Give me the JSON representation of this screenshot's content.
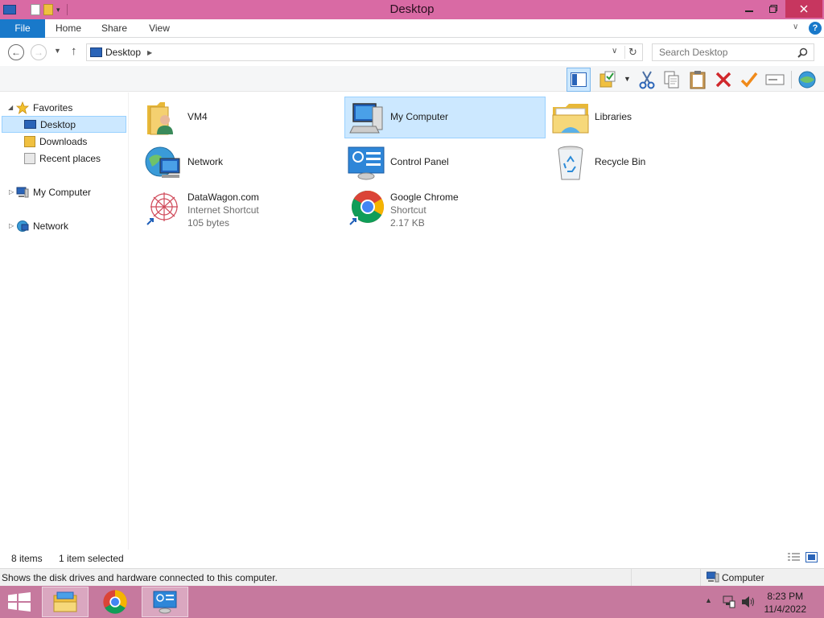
{
  "window": {
    "title": "Desktop"
  },
  "ribbon": {
    "tabs": [
      "File",
      "Home",
      "Share",
      "View"
    ],
    "help": "?"
  },
  "address": {
    "path": "Desktop",
    "search_placeholder": "Search Desktop"
  },
  "navpane": {
    "favorites": "Favorites",
    "items": [
      "Desktop",
      "Downloads",
      "Recent places"
    ],
    "computer": "My Computer",
    "network": "Network"
  },
  "items": [
    {
      "name": "VM4"
    },
    {
      "name": "My Computer"
    },
    {
      "name": "Libraries"
    },
    {
      "name": "Network"
    },
    {
      "name": "Control Panel"
    },
    {
      "name": "Recycle Bin"
    },
    {
      "name": "DataWagon.com",
      "type": "Internet Shortcut",
      "size": "105 bytes"
    },
    {
      "name": "Google Chrome",
      "type": "Shortcut",
      "size": "2.17 KB"
    }
  ],
  "status": {
    "count": "8 items",
    "selected": "1 item selected",
    "info": "Shows the disk drives and hardware connected to this computer.",
    "location": "Computer"
  },
  "taskbar": {
    "time": "8:23 PM",
    "date": "11/4/2022"
  },
  "colors": {
    "titlebar": "#d96aa4",
    "accent": "#1979ca",
    "selection": "#cce8ff",
    "taskbar": "#c6799e",
    "close": "#c7365f"
  }
}
